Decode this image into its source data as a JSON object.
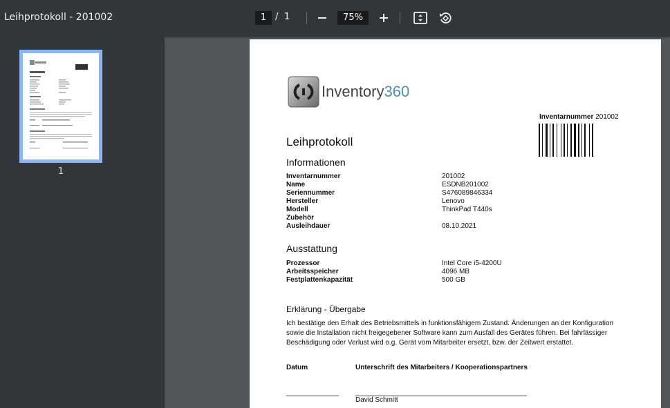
{
  "toolbar": {
    "title": "Leihprotokoll - 201002",
    "current_page": "1",
    "page_separator": "/",
    "total_pages": "1",
    "zoom": "75%"
  },
  "sidebar": {
    "thumbnail_label": "1"
  },
  "document": {
    "logo_text_a": "Inventory",
    "logo_text_b": "360",
    "logo_color": "#4a8fb8",
    "inventar_label": "Inventarnummer",
    "inventar_value": "201002",
    "title": "Leihprotokoll",
    "info_heading": "Informationen",
    "info_rows": [
      {
        "label": "Inventarnummer",
        "value": "201002"
      },
      {
        "label": "Name",
        "value": "ESDNB201002"
      },
      {
        "label": "Seriennummer",
        "value": "S476089846334"
      },
      {
        "label": "Hersteller",
        "value": "Lenovo"
      },
      {
        "label": "Modell",
        "value": "ThinkPad T440s"
      },
      {
        "label": "Zubehör",
        "value": ""
      },
      {
        "label": "Ausleihdauer",
        "value": "08.10.2021"
      }
    ],
    "ausstattung_heading": "Ausstattung",
    "ausstattung_rows": [
      {
        "label": "Prozessor",
        "value": "Intel Core i5-4200U"
      },
      {
        "label": "Arbeitsspeicher",
        "value": "4096 MB"
      },
      {
        "label": "Festplattenkapazität",
        "value": "500 GB"
      }
    ],
    "erklaerung_heading": "Erklärung - Übergabe",
    "erklaerung_text": "Ich bestätige den Erhalt des Betriebsmittels in funktionsfähigem Zustand. Änderungen an der Konfiguration sowie die Installation nicht freigegebener Software kann zum Ausfall des Gerätes führen. Bei fahrlässiger Beschädigung oder Verlust wird o.g. Gerät vom Mitarbeiter ersetzt, bzw. der Zeitwert erstattet.",
    "datum_label": "Datum",
    "unterschrift_label": "Unterschrift des Mitarbeiters / Kooperationspartners",
    "signer_name": "David Schmitt"
  }
}
